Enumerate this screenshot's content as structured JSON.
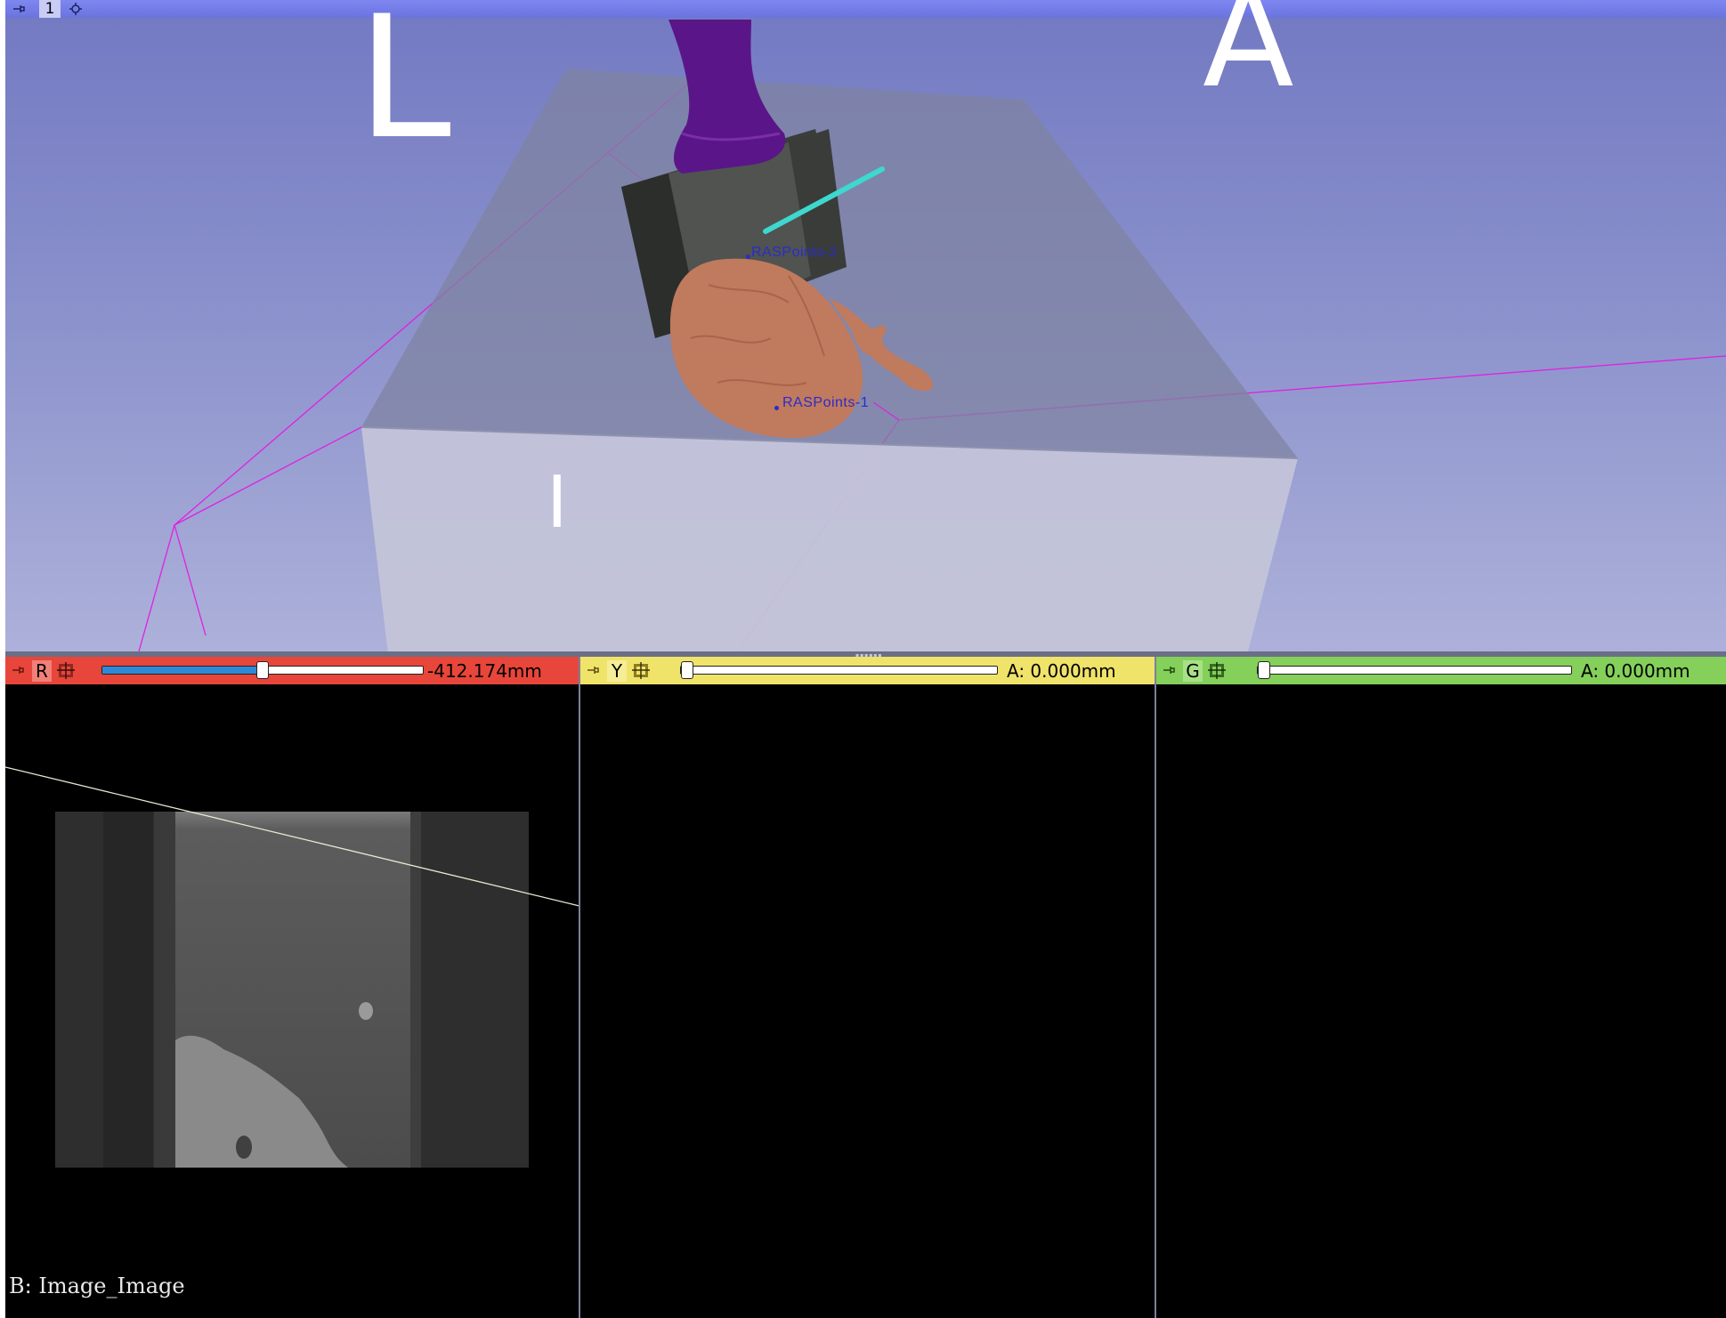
{
  "view3d": {
    "layout_number": "1",
    "orientation_labels": {
      "left": "L",
      "anterior": "A",
      "inferior": "I"
    },
    "fiducials": [
      "RASPoints-2",
      "RASPoints-1"
    ],
    "background_gradient": [
      "#7379c2",
      "#adb1da"
    ],
    "bbox_color": "#e020e0",
    "model_colors": {
      "brain": "#c07a5e",
      "vessel": "#5a1688",
      "probe": "#3dd8cf",
      "box": "#464a48"
    }
  },
  "red_slice": {
    "letter": "R",
    "offset": "-412.174mm",
    "slider_fraction": 0.5,
    "color": "#e8463a",
    "background_label": "B: Image_Image"
  },
  "yellow_slice": {
    "letter": "Y",
    "offset": "A: 0.000mm",
    "slider_fraction": 0.0,
    "color": "#f0e36a"
  },
  "green_slice": {
    "letter": "G",
    "offset": "A: 0.000mm",
    "slider_fraction": 0.0,
    "color": "#84d05a"
  },
  "icons": [
    "pin-icon",
    "settings-icon",
    "link-icon"
  ]
}
